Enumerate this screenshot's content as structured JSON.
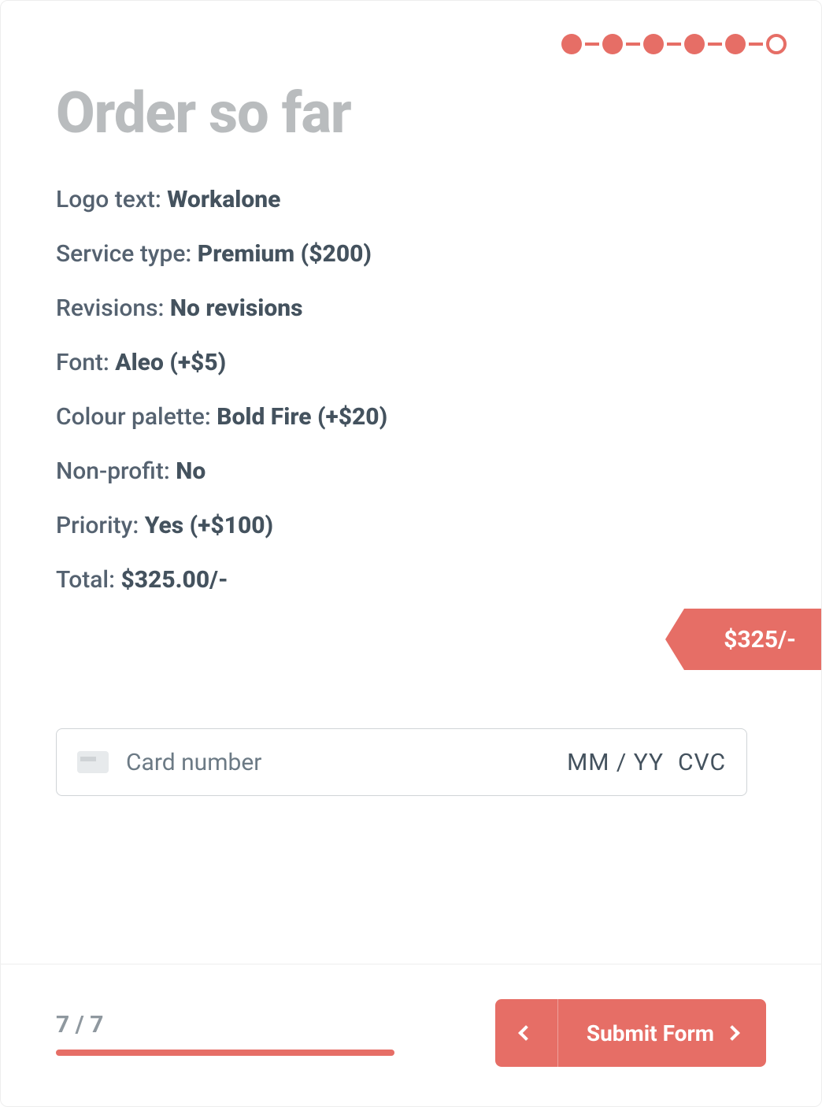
{
  "colors": {
    "accent": "#e66e66",
    "text": "#425563",
    "muted": "#b9bcbe"
  },
  "stepper": {
    "total": 6,
    "current": 6
  },
  "title": "Order so far",
  "summary": [
    {
      "label": "Logo text: ",
      "value": "Workalone"
    },
    {
      "label": "Service type: ",
      "value": "Premium ($200)"
    },
    {
      "label": "Revisions: ",
      "value": "No revisions"
    },
    {
      "label": "Font: ",
      "value": "Aleo (+$5)"
    },
    {
      "label": "Colour palette: ",
      "value": "Bold Fire (+$20)"
    },
    {
      "label": "Non-profit: ",
      "value": "No"
    },
    {
      "label": "Priority: ",
      "value": "Yes (+$100)"
    },
    {
      "label": "Total: ",
      "value": "$325.00/-"
    }
  ],
  "price_tag": "$325/-",
  "card_input": {
    "placeholder_number": "Card number",
    "placeholder_expiry": "MM / YY",
    "placeholder_cvc": "CVC"
  },
  "footer": {
    "progress_label": "7 / 7",
    "progress_value": 7,
    "progress_max": 7,
    "submit_label": "Submit Form"
  }
}
